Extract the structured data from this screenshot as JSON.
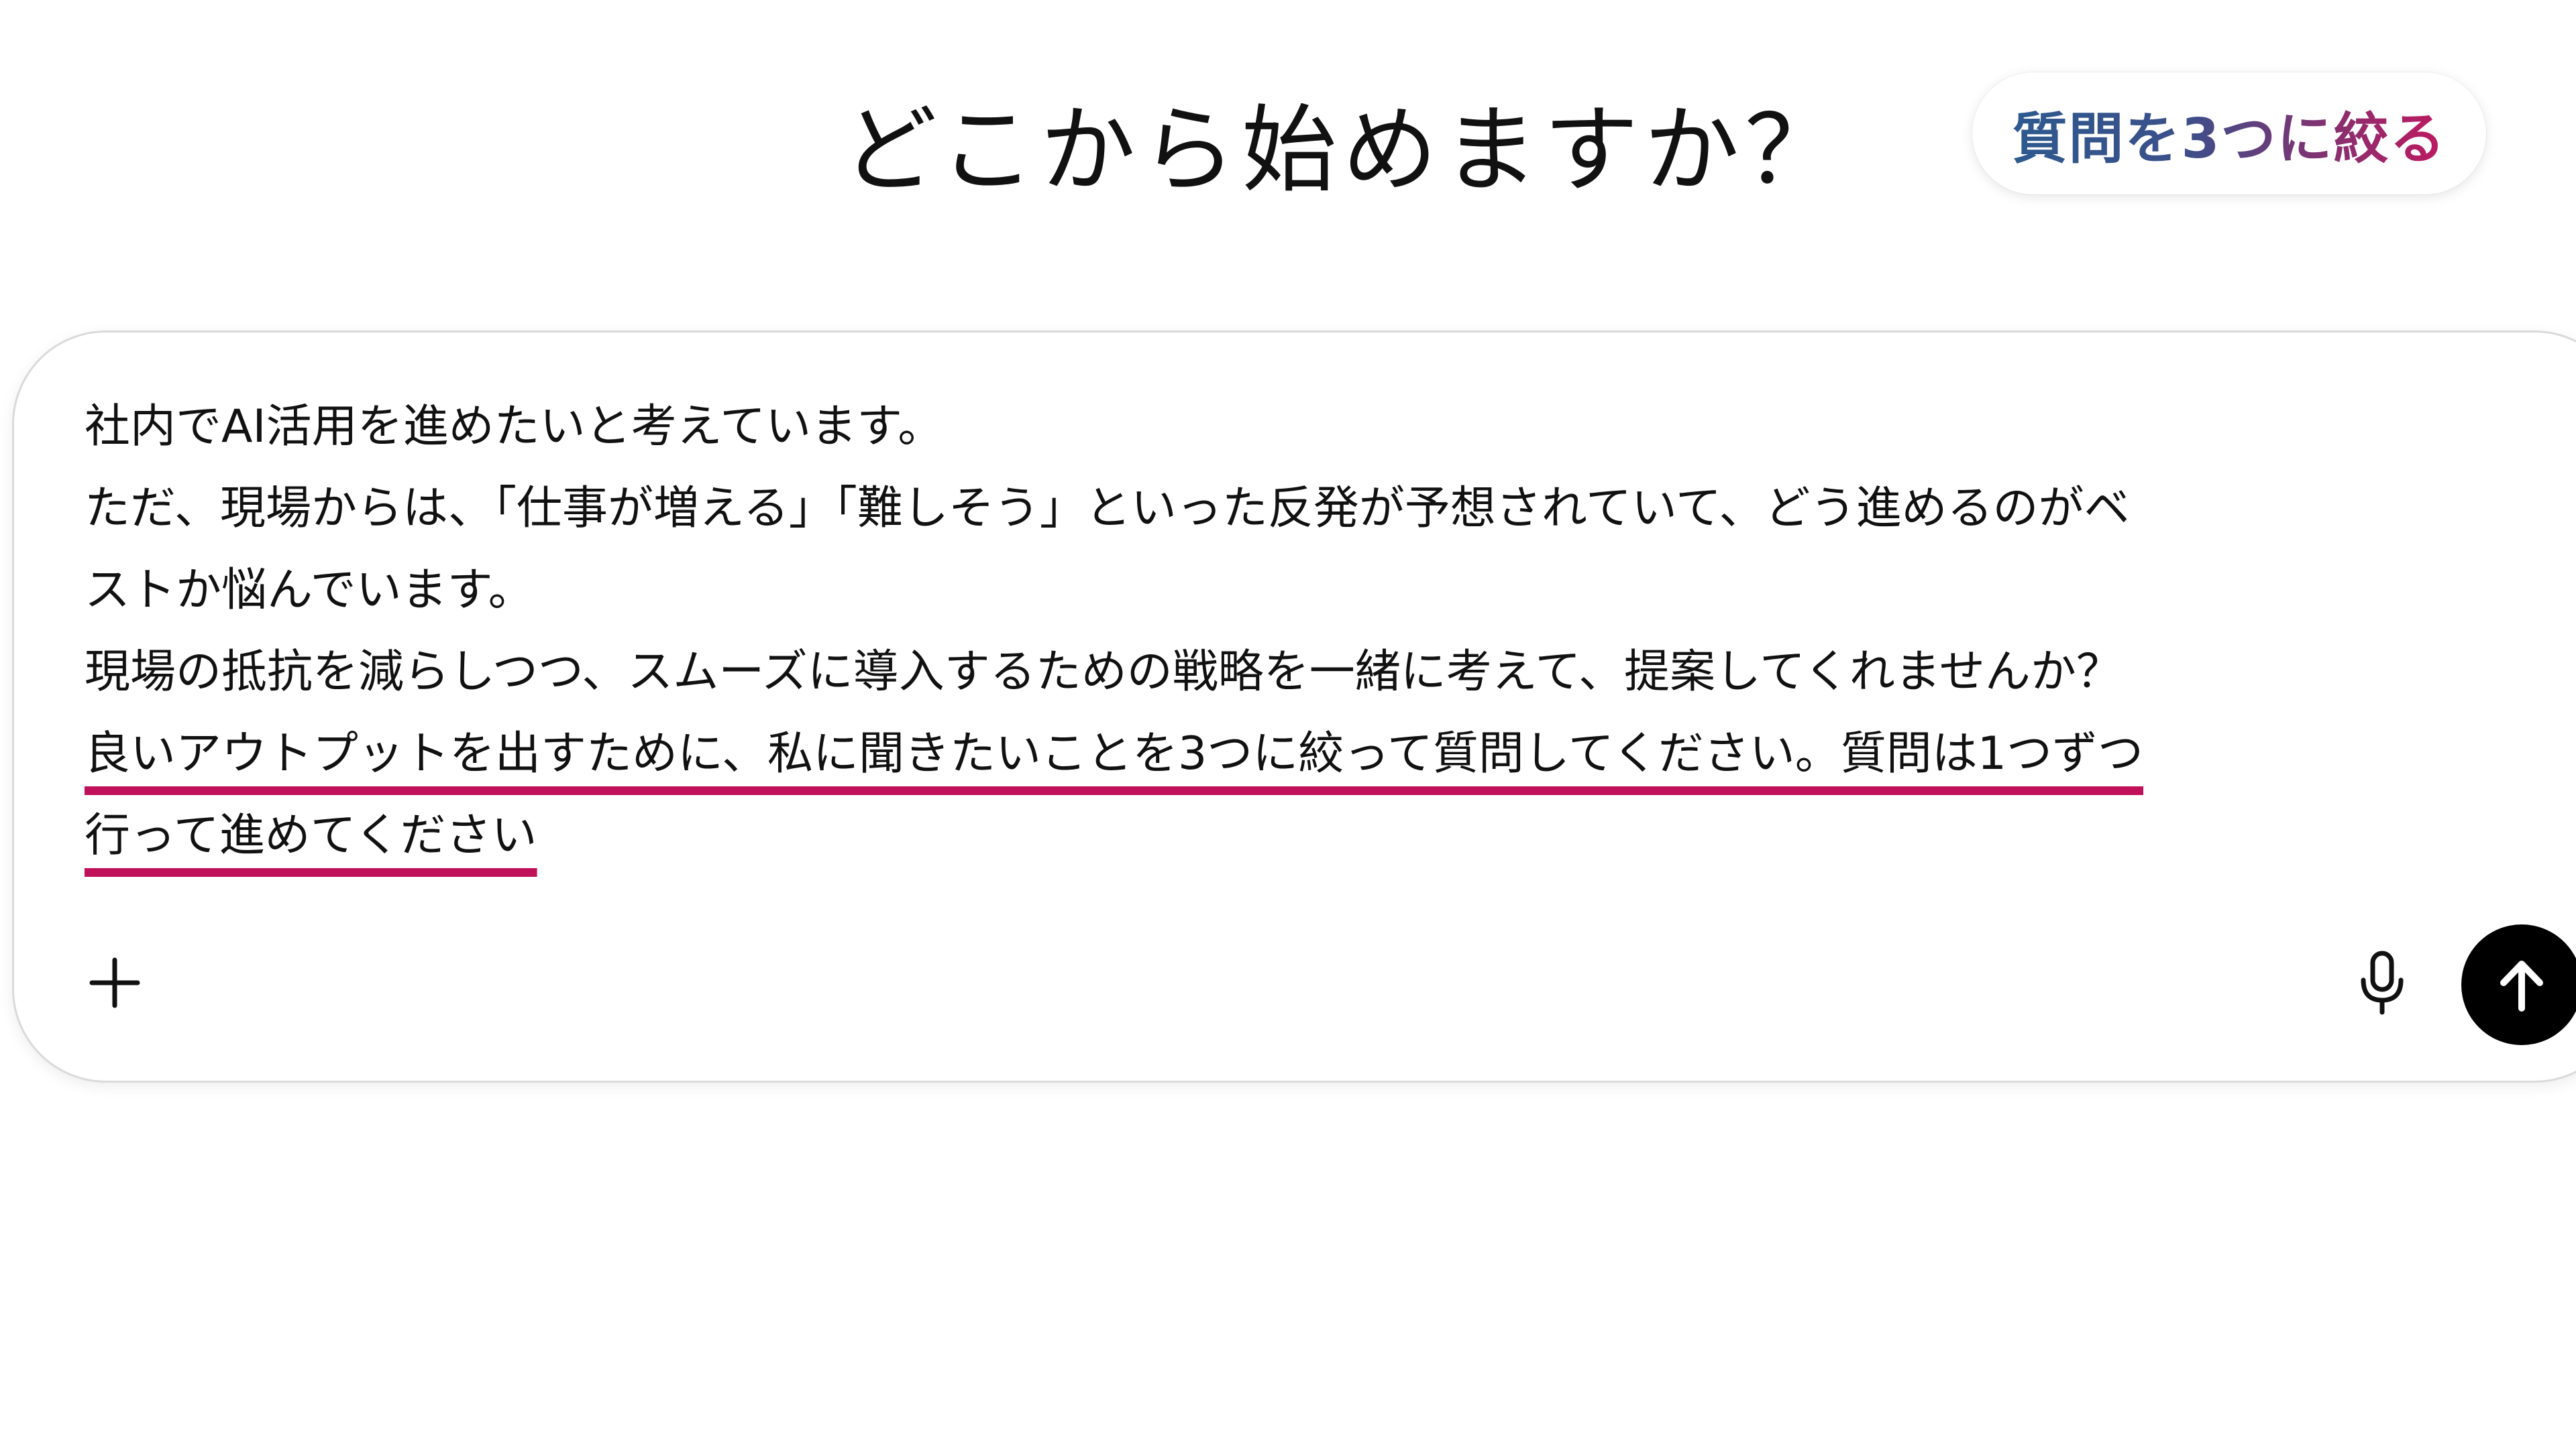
{
  "header": {
    "title": "どこから始めますか？"
  },
  "hint_pill": {
    "label": "質問を3つに絞る",
    "gradient_colors": [
      "#2d5a8e",
      "#c01860"
    ]
  },
  "composer": {
    "lines": [
      {
        "text": "社内でAI活用を進めたいと考えています。"
      },
      {
        "text": "ただ、現場からは、「仕事が増える」「難しそう」といった反発が予想されていて、どう進めるのがベ"
      },
      {
        "text": "ストか悩んでいます。"
      },
      {
        "text": "現場の抵抗を減らしつつ、スムーズに導入するための戦略を一緒に考えて、提案してくれませんか？"
      },
      {
        "text": "良いアウトプットを出すために、私に聞きたいことを3つに絞って質問してください。質問は1つずつ"
      },
      {
        "text": "行って進めてください"
      }
    ],
    "highlight_color": "#c0105a",
    "add_icon": "plus-icon",
    "mic_icon": "microphone-icon",
    "send_icon": "arrow-up-icon"
  }
}
